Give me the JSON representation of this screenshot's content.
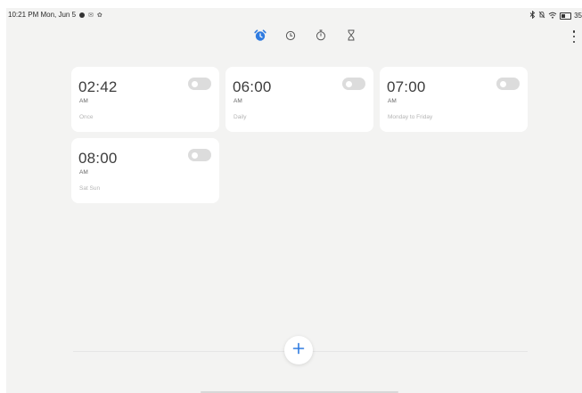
{
  "status_bar": {
    "time_date": "10:21 PM Mon, Jun 5",
    "battery_level": "35"
  },
  "tabs": [
    {
      "name": "Alarm",
      "icon": "alarm-clock-icon",
      "active": true
    },
    {
      "name": "Clock",
      "icon": "clock-icon",
      "active": false
    },
    {
      "name": "Stopwatch",
      "icon": "stopwatch-icon",
      "active": false
    },
    {
      "name": "Timer",
      "icon": "hourglass-icon",
      "active": false
    }
  ],
  "colors": {
    "accent": "#2f7be0",
    "background": "#f3f3f2",
    "card": "#ffffff",
    "toggle_off": "#dcdcdc"
  },
  "alarms": [
    {
      "time": "02:42",
      "ampm": "AM",
      "repeat": "Once",
      "enabled": false
    },
    {
      "time": "06:00",
      "ampm": "AM",
      "repeat": "Daily",
      "enabled": false
    },
    {
      "time": "07:00",
      "ampm": "AM",
      "repeat": "Monday to Friday",
      "enabled": false
    },
    {
      "time": "08:00",
      "ampm": "AM",
      "repeat": "Sat Sun",
      "enabled": false
    }
  ]
}
